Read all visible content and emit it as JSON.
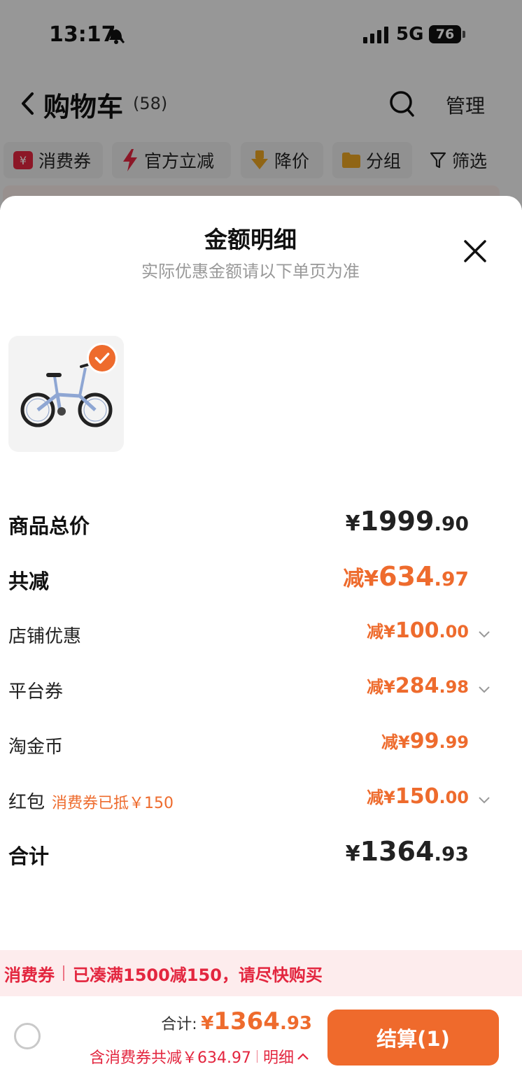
{
  "status_bar": {
    "time": "13:17",
    "network": "5G",
    "battery": "76"
  },
  "nav": {
    "title": "购物车",
    "count": "(58)",
    "manage": "管理"
  },
  "filters": [
    {
      "label": "消费券",
      "icon": "coupon-icon"
    },
    {
      "label": "官方立减",
      "icon": "lightning-icon"
    },
    {
      "label": "降价",
      "icon": "price-down-icon"
    },
    {
      "label": "分组",
      "icon": "folder-icon"
    },
    {
      "label": "筛选",
      "icon": "filter-icon"
    }
  ],
  "sheet": {
    "title": "金额明细",
    "subtitle": "实际优惠金额请以下单页为准",
    "product": {
      "image": "folding-bike",
      "selected": true
    },
    "rows": {
      "goods_total": {
        "label": "商品总价",
        "pre": "¥",
        "int": "1999",
        "dec": ".90"
      },
      "total_discount": {
        "label": "共减",
        "pre": "减¥",
        "int": "634",
        "dec": ".97"
      },
      "store_discount": {
        "label": "店铺优惠",
        "pre": "减¥",
        "int": "100",
        "dec": ".00"
      },
      "platform_coupon": {
        "label": "平台券",
        "pre": "减¥",
        "int": "284",
        "dec": ".98"
      },
      "taojinbi": {
        "label": "淘金币",
        "pre": "减¥",
        "int": "99",
        "dec": ".99"
      },
      "red_packet": {
        "label": "红包",
        "note": "消费券已抵￥150",
        "pre": "减¥",
        "int": "150",
        "dec": ".00"
      },
      "sum": {
        "label": "合计",
        "pre": "¥",
        "int": "1364",
        "dec": ".93"
      }
    }
  },
  "promo": {
    "tag": "消费券",
    "text": "已凑满1500减150，请尽快购买"
  },
  "checkout": {
    "total_label": "合计:",
    "pre": "¥",
    "int": "1364",
    "dec": ".93",
    "saving": "含消费券共减￥634.97",
    "detail": "明细",
    "pay_label": "结算(1)"
  },
  "colors": {
    "accent": "#ee6b2d",
    "promo_red": "#e3263f"
  }
}
